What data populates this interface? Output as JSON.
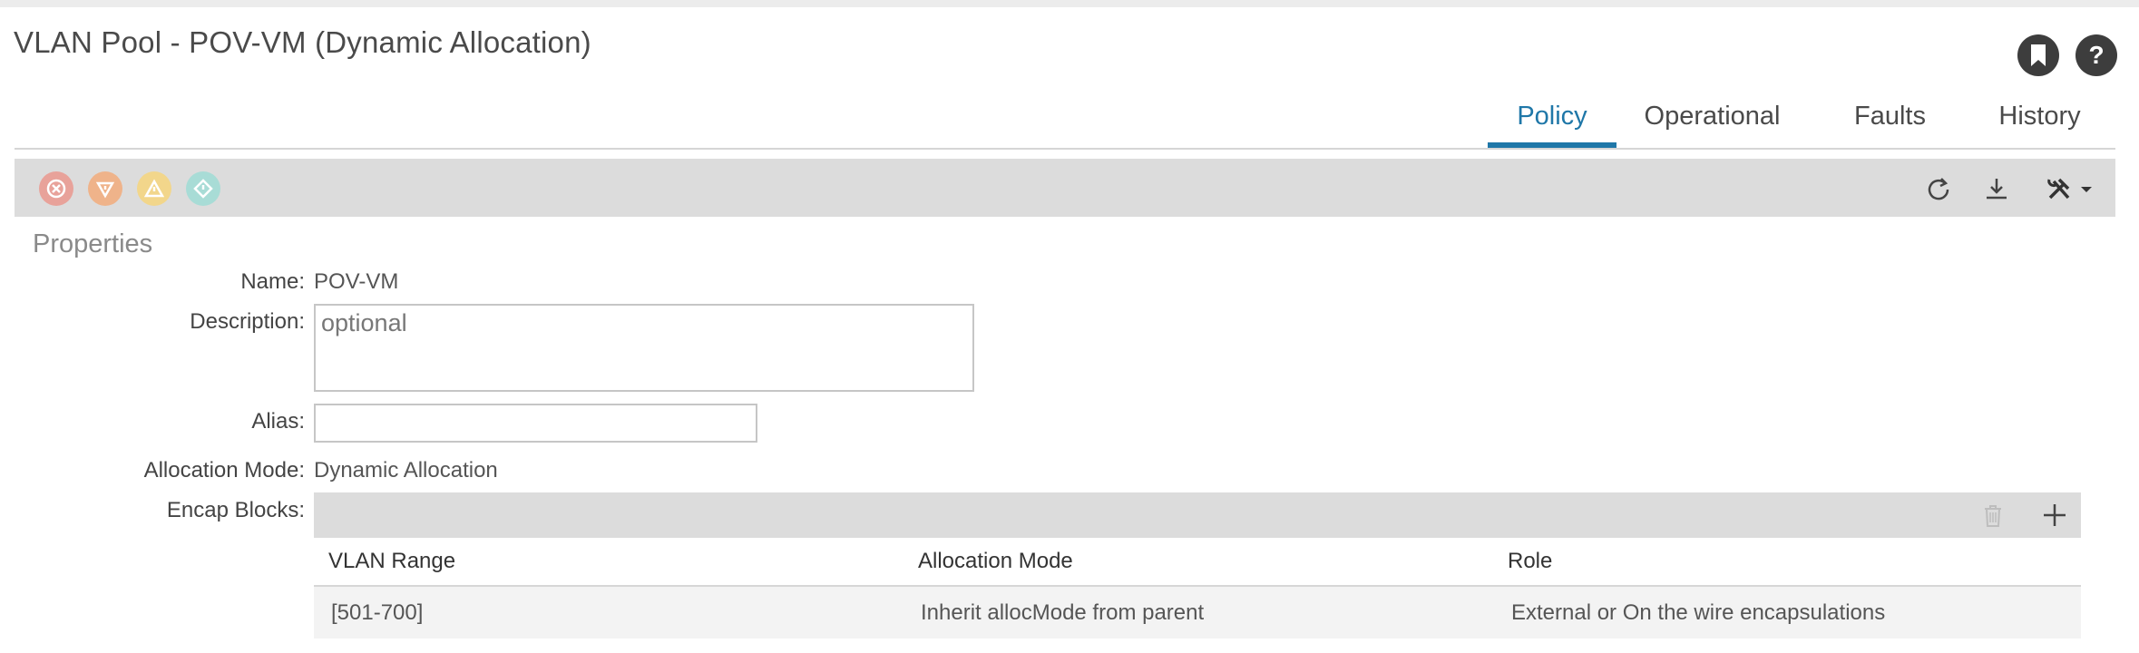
{
  "header": {
    "title": "VLAN Pool - POV-VM (Dynamic Allocation)",
    "bookmark_icon": "bookmark-icon",
    "help_icon": "help-icon",
    "help_glyph": "?"
  },
  "tabs": [
    {
      "label": "Policy",
      "active": true
    },
    {
      "label": "Operational",
      "active": false
    },
    {
      "label": "Faults",
      "active": false
    },
    {
      "label": "History",
      "active": false
    }
  ],
  "toolbar": {
    "fault_icons": [
      {
        "name": "critical-fault-icon",
        "color": "#e8a29a"
      },
      {
        "name": "major-fault-icon",
        "color": "#efb38a"
      },
      {
        "name": "minor-fault-icon",
        "color": "#f2d68b"
      },
      {
        "name": "warning-fault-icon",
        "color": "#a8dcd6"
      }
    ],
    "right_icons": [
      "refresh-icon",
      "download-icon",
      "tools-icon"
    ]
  },
  "properties": {
    "section_title": "Properties",
    "name_label": "Name:",
    "name_value": "POV-VM",
    "description_label": "Description:",
    "description_placeholder": "optional",
    "description_value": "",
    "alias_label": "Alias:",
    "alias_value": "",
    "allocation_mode_label": "Allocation Mode:",
    "allocation_mode_value": "Dynamic Allocation",
    "encap_blocks_label": "Encap Blocks:"
  },
  "encap_table": {
    "columns": [
      "VLAN Range",
      "Allocation Mode",
      "Role"
    ],
    "rows": [
      [
        "[501-700]",
        "Inherit allocMode from parent",
        "External or On the wire encapsulations"
      ]
    ],
    "actions": [
      "trash-icon",
      "add-icon"
    ]
  },
  "colors": {
    "accent": "#1f77a8",
    "toolbar_bg": "#dcdcdc",
    "row_bg": "#f3f3f3"
  }
}
